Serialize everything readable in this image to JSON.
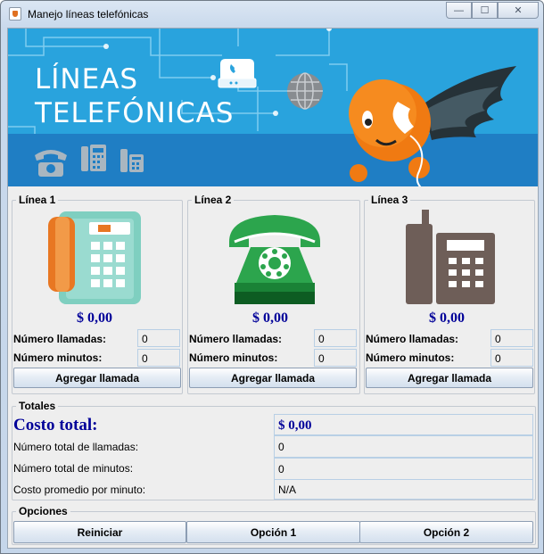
{
  "window": {
    "title": "Manejo líneas telefónicas",
    "minimize": "—",
    "maximize": "☐",
    "close": "✕"
  },
  "banner": {
    "line1": "LÍNEAS",
    "line2": "TELEFÓNICAS"
  },
  "lines": [
    {
      "title": "Línea 1",
      "cost": "$ 0,00",
      "calls_label": "Número llamadas:",
      "calls": "0",
      "minutes_label": "Número minutos:",
      "minutes": "0",
      "button": "Agregar llamada",
      "phone_color": "#7fcfc0"
    },
    {
      "title": "Línea 2",
      "cost": "$ 0,00",
      "calls_label": "Número llamadas:",
      "calls": "0",
      "minutes_label": "Número minutos:",
      "minutes": "0",
      "button": "Agregar llamada",
      "phone_color": "#2ca54d"
    },
    {
      "title": "Línea 3",
      "cost": "$ 0,00",
      "calls_label": "Número llamadas:",
      "calls": "0",
      "minutes_label": "Número minutos:",
      "minutes": "0",
      "button": "Agregar llamada",
      "phone_color": "#6e5e58"
    }
  ],
  "totals": {
    "title": "Totales",
    "cost_label": "Costo total:",
    "cost": "$ 0,00",
    "calls_label": "Número total de llamadas:",
    "calls": "0",
    "minutes_label": "Número total de minutos:",
    "minutes": "0",
    "avg_label": "Costo promedio por minuto:",
    "avg": "N/A"
  },
  "options": {
    "title": "Opciones",
    "reset": "Reiniciar",
    "option1": "Opción 1",
    "option2": "Opción 2"
  }
}
